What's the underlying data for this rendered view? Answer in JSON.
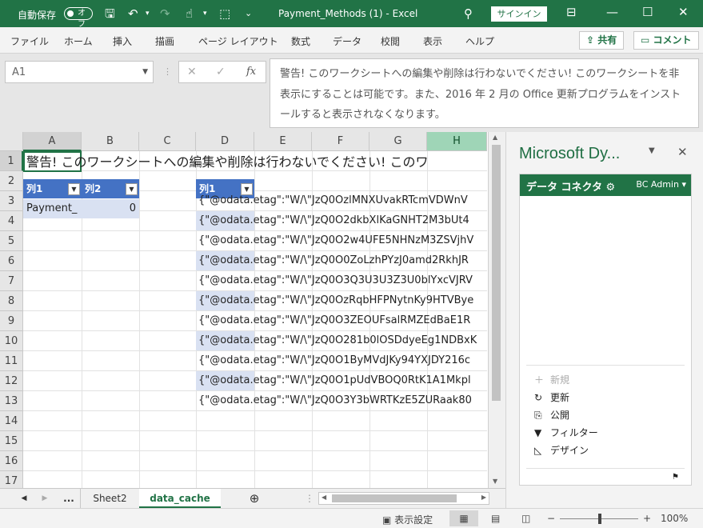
{
  "titlebar": {
    "autosave_label": "自動保存",
    "autosave_state": "オフ",
    "document_title": "Payment_Methods (1)  -  Excel",
    "signin_label": "サインイン"
  },
  "ribbon": {
    "tabs": [
      "ファイル",
      "ホーム",
      "挿入",
      "描画",
      "ページ レイアウト",
      "数式",
      "データ",
      "校閲",
      "表示",
      "ヘルプ"
    ],
    "share_label": "共有",
    "comments_label": "コメント"
  },
  "formula_bar": {
    "name_box": "A1",
    "fx": "fx",
    "content": "警告! このワークシートへの編集や削除は行わないでください! このワークシートを非表示にすることは可能です。また、2016 年 2 月の Office 更新プログラムをインストールすると表示されなくなります。"
  },
  "grid": {
    "columns": [
      "A",
      "B",
      "C",
      "D",
      "E",
      "F",
      "G",
      "H"
    ],
    "rows": [
      "1",
      "2",
      "3",
      "4",
      "5",
      "6",
      "7",
      "8",
      "9",
      "10",
      "11",
      "12",
      "13",
      "14",
      "15",
      "16",
      "17"
    ],
    "a1": "警告! このワークシートへの編集や削除は行わないでください! このワ",
    "table1": {
      "headers": [
        "列1",
        "列2"
      ],
      "row": [
        "Payment_",
        "0"
      ]
    },
    "table2": {
      "header": "列1",
      "cells": [
        "{\"@odata.etag\":\"W/\\\"JzQ0OzlMNXUvakRTcmVDWnV",
        "{\"@odata.etag\":\"W/\\\"JzQ0O2dkbXlKaGNHT2M3bUt4",
        "{\"@odata.etag\":\"W/\\\"JzQ0O2w4UFE5NHNzM3ZSVjhV",
        "{\"@odata.etag\":\"W/\\\"JzQ0O0ZoLzhPYzJ0amd2RkhJR",
        "{\"@odata.etag\":\"W/\\\"JzQ0O3Q3U3U3Z3U0blYxcVJRV",
        "{\"@odata.etag\":\"W/\\\"JzQ0OzRqbHFPNytnKy9HTVBye",
        "{\"@odata.etag\":\"W/\\\"JzQ0O3ZEOUFsalRMZEdBaE1R",
        "{\"@odata.etag\":\"W/\\\"JzQ0O281b0lOSDdyeEg1NDBxK",
        "{\"@odata.etag\":\"W/\\\"JzQ0O1ByMVdJKy94YXJDY216c",
        "{\"@odata.etag\":\"W/\\\"JzQ0O1pUdVBOQ0RtK1A1Mkpl",
        "{\"@odata.etag\":\"W/\\\"JzQ0O3Y3bWRTKzE5ZURaak80"
      ]
    }
  },
  "sheets": {
    "more": "...",
    "tabs": [
      "Sheet2",
      "data_cache"
    ],
    "active": "data_cache"
  },
  "status": {
    "display_settings": "表示設定",
    "zoom": "100%"
  },
  "pane": {
    "title": "Microsoft Dy...",
    "connector_title": "データ コネクタ",
    "user": "BC Admin",
    "menu": [
      {
        "label": "新規",
        "icon": "plus-icon",
        "disabled": true
      },
      {
        "label": "更新",
        "icon": "refresh-icon"
      },
      {
        "label": "公開",
        "icon": "publish-icon"
      },
      {
        "label": "フィルター",
        "icon": "filter-icon"
      },
      {
        "label": "デザイン",
        "icon": "design-icon"
      }
    ]
  }
}
